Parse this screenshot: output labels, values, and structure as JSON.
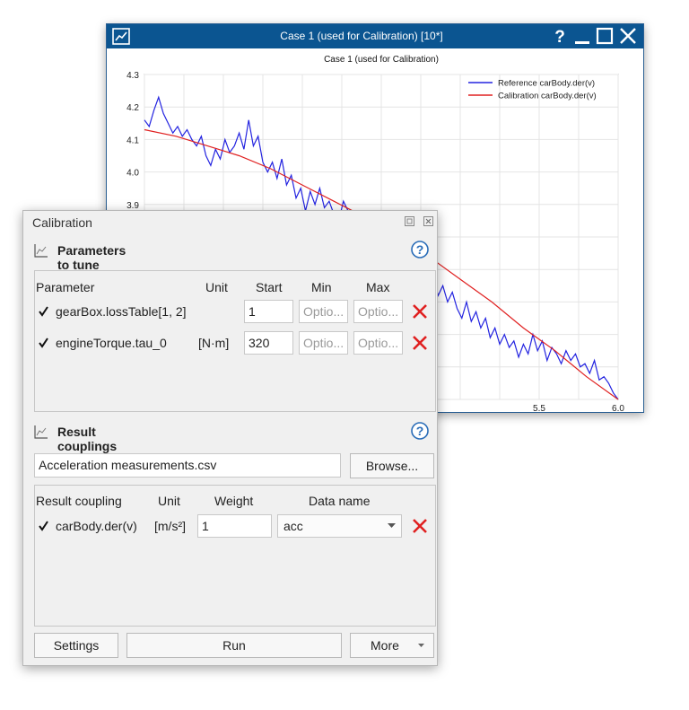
{
  "plot_window": {
    "title": "Case 1 (used for Calibration) [10*]",
    "buttons": [
      "help",
      "minimize",
      "maximize",
      "close"
    ]
  },
  "chart_data": {
    "type": "line",
    "title": "Case 1 (used for Calibration)",
    "xlim": [
      3.0,
      6.0
    ],
    "ylim": [
      3.3,
      4.3
    ],
    "y_ticks": [
      "4.3",
      "4.2",
      "4.1",
      "4.0",
      "3.9"
    ],
    "x_ticks": [
      "5.5",
      "6.0"
    ],
    "grid": true,
    "legend_placement": "top-right",
    "series": [
      {
        "name": "Reference carBody.der(v)",
        "color": "#2323e0",
        "x": [
          3.0,
          3.03,
          3.06,
          3.09,
          3.12,
          3.15,
          3.18,
          3.21,
          3.24,
          3.27,
          3.3,
          3.33,
          3.36,
          3.39,
          3.42,
          3.45,
          3.48,
          3.51,
          3.54,
          3.57,
          3.6,
          3.63,
          3.66,
          3.69,
          3.72,
          3.75,
          3.78,
          3.81,
          3.84,
          3.87,
          3.9,
          3.93,
          3.96,
          3.99,
          4.02,
          4.05,
          4.08,
          4.11,
          4.14,
          4.17,
          4.2,
          4.23,
          4.26,
          4.29,
          4.32,
          4.35,
          4.38,
          4.41,
          4.44,
          4.47,
          4.5,
          4.53,
          4.56,
          4.59,
          4.62,
          4.65,
          4.68,
          4.71,
          4.74,
          4.77,
          4.8,
          4.83,
          4.86,
          4.89,
          4.92,
          4.95,
          4.98,
          5.01,
          5.04,
          5.07,
          5.1,
          5.13,
          5.16,
          5.19,
          5.22,
          5.25,
          5.28,
          5.31,
          5.34,
          5.37,
          5.4,
          5.43,
          5.46,
          5.49,
          5.52,
          5.55,
          5.58,
          5.61,
          5.64,
          5.67,
          5.7,
          5.73,
          5.76,
          5.79,
          5.82,
          5.85,
          5.88,
          5.91,
          5.94,
          5.97,
          6.0
        ],
        "y": [
          4.16,
          4.14,
          4.19,
          4.23,
          4.18,
          4.15,
          4.12,
          4.14,
          4.11,
          4.13,
          4.1,
          4.08,
          4.11,
          4.05,
          4.02,
          4.07,
          4.04,
          4.1,
          4.06,
          4.08,
          4.12,
          4.07,
          4.16,
          4.08,
          4.11,
          4.03,
          4.0,
          4.03,
          3.98,
          4.04,
          3.96,
          3.99,
          3.92,
          3.95,
          3.88,
          3.94,
          3.9,
          3.95,
          3.89,
          3.91,
          3.87,
          3.85,
          3.91,
          3.88,
          3.82,
          3.86,
          3.79,
          3.84,
          3.8,
          3.76,
          3.79,
          3.74,
          3.77,
          3.71,
          3.74,
          3.68,
          3.71,
          3.69,
          3.66,
          3.7,
          3.65,
          3.67,
          3.62,
          3.65,
          3.6,
          3.63,
          3.58,
          3.55,
          3.6,
          3.54,
          3.57,
          3.52,
          3.55,
          3.49,
          3.52,
          3.47,
          3.5,
          3.46,
          3.48,
          3.43,
          3.47,
          3.44,
          3.5,
          3.45,
          3.48,
          3.42,
          3.46,
          3.44,
          3.41,
          3.45,
          3.42,
          3.44,
          3.4,
          3.41,
          3.38,
          3.42,
          3.36,
          3.37,
          3.35,
          3.32,
          3.3
        ]
      },
      {
        "name": "Calibration carBody.der(v)",
        "color": "#e02020",
        "x": [
          3.0,
          3.2,
          3.4,
          3.6,
          3.8,
          4.0,
          4.2,
          4.4,
          4.6,
          4.8,
          5.0,
          5.2,
          5.4,
          5.6,
          5.8,
          6.0
        ],
        "y": [
          4.13,
          4.11,
          4.08,
          4.05,
          4.01,
          3.96,
          3.91,
          3.86,
          3.8,
          3.74,
          3.67,
          3.6,
          3.52,
          3.45,
          3.37,
          3.3
        ]
      }
    ]
  },
  "calibration": {
    "panel_title": "Calibration",
    "params_section": {
      "title": "Parameters to tune",
      "headers": {
        "parameter": "Parameter",
        "unit": "Unit",
        "start": "Start",
        "min": "Min",
        "max": "Max"
      },
      "rows": [
        {
          "name": "gearBox.lossTable[1, 2]",
          "unit": "",
          "start": "1",
          "min_placeholder": "Optio...",
          "max_placeholder": "Optio...",
          "checked": true
        },
        {
          "name": "engineTorque.tau_0",
          "unit": "[N·m]",
          "start": "320",
          "min_placeholder": "Optio...",
          "max_placeholder": "Optio...",
          "checked": true
        }
      ]
    },
    "couplings_section": {
      "title": "Result couplings",
      "file": "Acceleration measurements.csv",
      "browse_label": "Browse...",
      "headers": {
        "coupling": "Result coupling",
        "unit": "Unit",
        "weight": "Weight",
        "data_name": "Data name"
      },
      "rows": [
        {
          "name": "carBody.der(v)",
          "unit": "[m/s²]",
          "weight": "1",
          "data_name": "acc",
          "checked": true
        }
      ]
    },
    "footer": {
      "settings": "Settings",
      "run": "Run",
      "more": "More"
    }
  },
  "colors": {
    "titlebar": "#0b5591",
    "delete_x": "#e02020",
    "help_blue": "#2a6db8"
  }
}
